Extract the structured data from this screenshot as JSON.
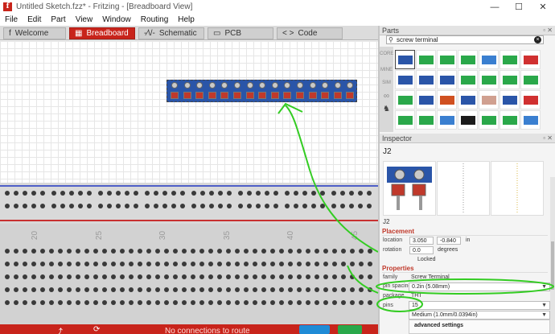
{
  "window": {
    "title": "Untitled Sketch.fzz* - Fritzing - [Breadboard View]",
    "app_letter": "f",
    "controls": {
      "minimize": "—",
      "maximize": "☐",
      "close": "✕"
    }
  },
  "menu": [
    "File",
    "Edit",
    "Part",
    "View",
    "Window",
    "Routing",
    "Help"
  ],
  "tabs": [
    {
      "label": "Welcome",
      "icon": "f"
    },
    {
      "label": "Breadboard",
      "icon": "▦"
    },
    {
      "label": "Schematic",
      "icon": "-⁄\\/-"
    },
    {
      "label": "PCB",
      "icon": "▭"
    },
    {
      "label": "Code",
      "icon": "< >"
    }
  ],
  "active_tab": "Breadboard",
  "breadboard": {
    "column_numbers": [
      "20",
      "25",
      "30",
      "35",
      "40",
      "45"
    ]
  },
  "status": {
    "routing": "No connections to route"
  },
  "parts": {
    "title": "Parts",
    "search_value": "screw terminal",
    "bins": [
      "CORE",
      "MINE",
      "SIM",
      "∞",
      "♞"
    ]
  },
  "inspector": {
    "title": "Inspector",
    "part_title": "J2",
    "part_label": "J2",
    "placement_header": "Placement",
    "location_label": "location",
    "location_x": "3.050",
    "location_y": "-0.840",
    "location_unit": "in",
    "rotation_label": "rotation",
    "rotation_value": "0.0",
    "rotation_unit": "degrees",
    "locked_label": "Locked",
    "properties_header": "Properties",
    "family_label": "family",
    "family_value": "Screw Terminal",
    "pin_spacing_label": "pin spacing",
    "pin_spacing_value": "0.2in (5.08mm)",
    "package_label": "package",
    "package_value": "THT",
    "pins_label": "pins",
    "pins_value": "15",
    "hole_value": "Medium (1.0mm/0.0394in)",
    "advanced_label": "advanced settings"
  },
  "colors": {
    "accent": "#c8241b",
    "terminal_blue": "#2a55a8",
    "annotation_green": "#33cc22"
  }
}
